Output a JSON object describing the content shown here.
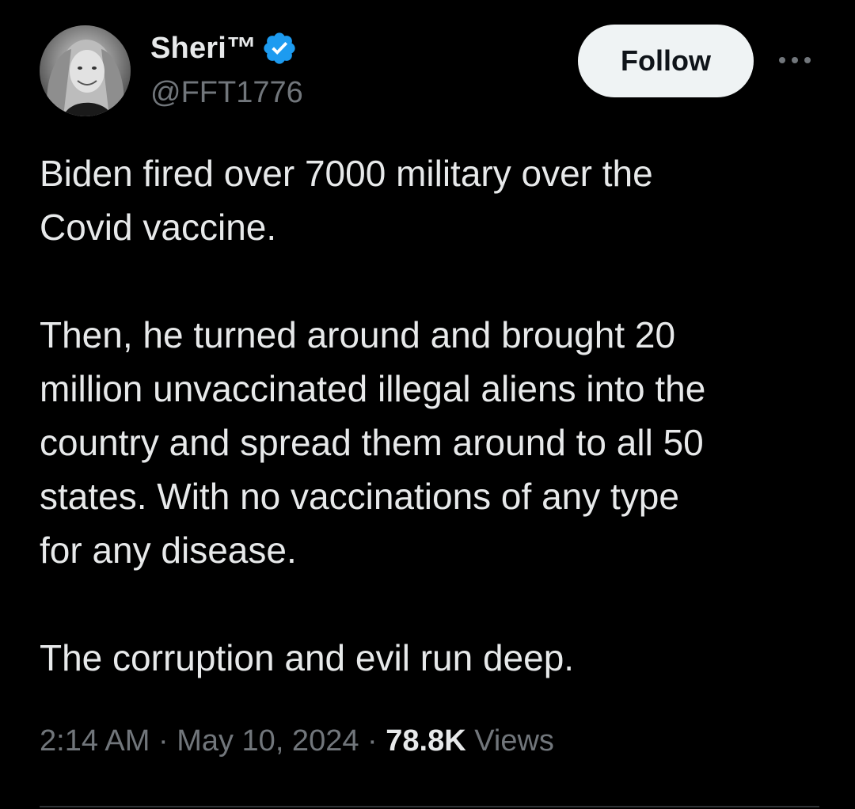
{
  "author": {
    "display_name": "Sheri™",
    "handle": "@FFT1776",
    "verified": true,
    "verified_color": "#1d9bf0",
    "avatar_icon": "profile-photo"
  },
  "follow_button": {
    "label": "Follow"
  },
  "more_menu_icon": "more-horizontal-icon",
  "tweet": {
    "paragraphs": [
      [
        "Biden fired over 7000 military over the",
        "Covid vaccine."
      ],
      [
        "Then, he turned around and brought 20",
        "million unvaccinated illegal aliens into the",
        "country and spread them around to all 50",
        "states.  With no vaccinations of any type",
        "for any disease."
      ],
      [
        "The corruption and evil run deep."
      ]
    ]
  },
  "meta": {
    "time": "2:14 AM",
    "separator": " · ",
    "date": "May 10, 2024",
    "views_count": "78.8K",
    "views_label": " Views"
  },
  "colors": {
    "background": "#000000",
    "primary_text": "#e7e9ea",
    "secondary_text": "#71767b",
    "follow_bg": "#eff3f4"
  }
}
